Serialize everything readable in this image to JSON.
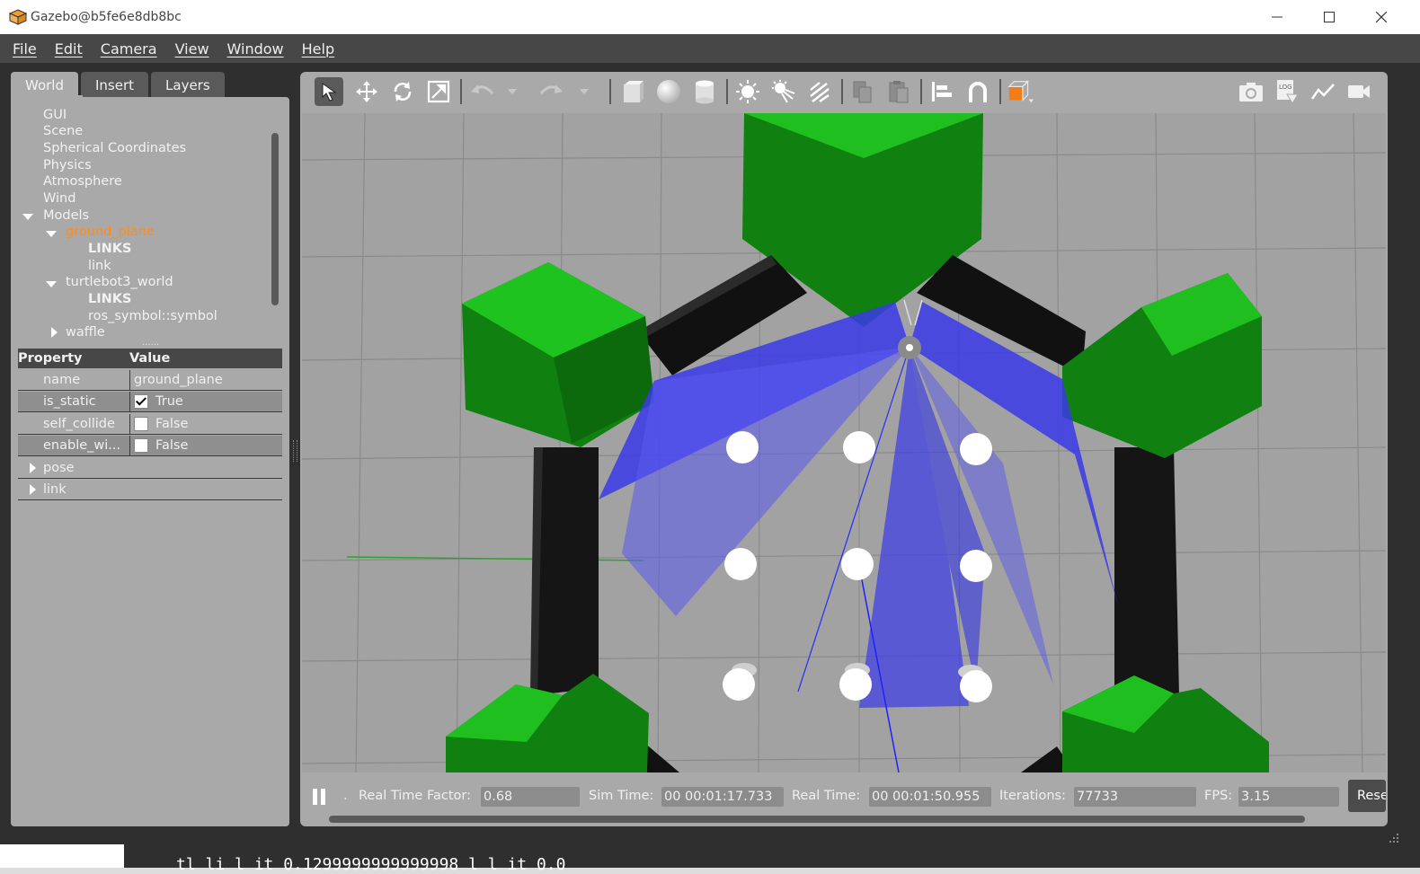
{
  "window": {
    "title": "Gazebo@b5fe6e8db8bc",
    "minimize_icon": "minimize-icon",
    "maximize_icon": "maximize-icon",
    "close_icon": "close-icon"
  },
  "menu": [
    "File",
    "Edit",
    "Camera",
    "View",
    "Window",
    "Help"
  ],
  "left_tabs": [
    "World",
    "Insert",
    "Layers"
  ],
  "tree": {
    "gui": "GUI",
    "scene": "Scene",
    "spherical": "Spherical Coordinates",
    "physics": "Physics",
    "atmosphere": "Atmosphere",
    "wind": "Wind",
    "models": "Models",
    "ground_plane": "ground_plane",
    "links1": "LINKS",
    "link1": "link",
    "turtlebot3_world": "turtlebot3_world",
    "links2": "LINKS",
    "ros_symbol": "ros_symbol::symbol",
    "waffle": "waffle",
    "more": "......"
  },
  "properties": {
    "header_property": "Property",
    "header_value": "Value",
    "rows": [
      {
        "name": "name",
        "value": "ground_plane"
      },
      {
        "name": "is_static",
        "value": "True",
        "checked": true
      },
      {
        "name": "self_collide",
        "value": "False",
        "checked": false
      },
      {
        "name": "enable_wi...",
        "value": "False",
        "checked": false
      }
    ],
    "pose": "pose",
    "link": "link"
  },
  "toolbar_icons": [
    "select-arrow-icon",
    "translate-icon",
    "rotate-icon",
    "scale-icon",
    "undo-icon",
    "redo-icon",
    "box-icon",
    "sphere-icon",
    "cylinder-icon",
    "point-light-icon",
    "spot-light-icon",
    "directional-light-icon",
    "copy-icon",
    "paste-icon",
    "align-icon",
    "snap-icon",
    "view-angle-icon",
    "screenshot-icon",
    "log-icon",
    "plot-icon",
    "record-video-icon"
  ],
  "status": {
    "dot": ".",
    "real_time_factor_label": "Real Time Factor:",
    "real_time_factor": "0.68",
    "sim_time_label": "Sim Time:",
    "sim_time": "00 00:01:17.733",
    "real_time_label": "Real Time:",
    "real_time": "00 00:01:50.955",
    "iterations_label": "Iterations:",
    "iterations": "77733",
    "fps_label": "FPS:",
    "fps": "3.15",
    "reset_label": "Reset"
  },
  "terminal_text": "  tl            li           l   it  0.1299999999999998           l      l   it  0.0",
  "colors": {
    "accent_orange": "#ff8c1a",
    "laser_blue": "#2a2aff",
    "obstacle_green": "#1fa51f",
    "wall_black": "#1a1a1a",
    "ground_gray": "#a0a0a0"
  }
}
